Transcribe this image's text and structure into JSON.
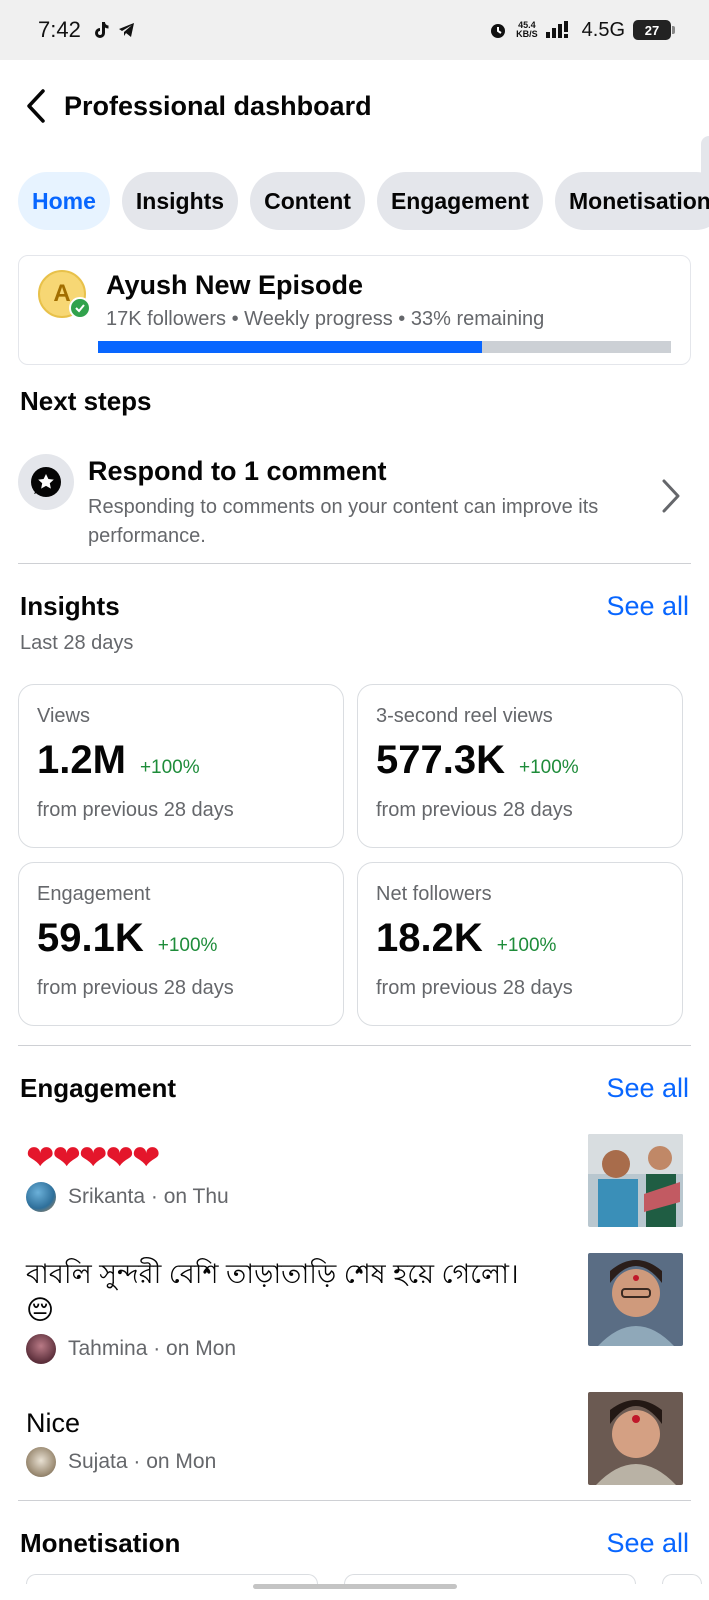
{
  "status_bar": {
    "time": "7:42",
    "speed_top": "45.4",
    "speed_bottom": "KB/S",
    "network": "4.5G",
    "battery": "27"
  },
  "header": {
    "title": "Professional dashboard"
  },
  "tabs": [
    {
      "label": "Home",
      "active": true
    },
    {
      "label": "Insights",
      "active": false
    },
    {
      "label": "Content",
      "active": false
    },
    {
      "label": "Engagement",
      "active": false
    },
    {
      "label": "Monetisation",
      "active": false
    }
  ],
  "profile": {
    "avatar_letter": "A",
    "name": "Ayush New Episode",
    "meta": "17K followers • Weekly progress • 33% remaining",
    "progress_fraction": 0.67
  },
  "next_steps": {
    "heading": "Next steps",
    "item": {
      "title": "Respond to 1 comment",
      "description": "Responding to comments on your content can improve its performance."
    }
  },
  "insights": {
    "heading": "Insights",
    "see_all": "See all",
    "period": "Last 28 days",
    "metrics": [
      {
        "label": "Views",
        "value": "1.2M",
        "change": "+100%",
        "foot": "from previous 28 days"
      },
      {
        "label": "3-second reel views",
        "value": "577.3K",
        "change": "+100%",
        "foot": "from previous 28 days"
      },
      {
        "label": "Engagement",
        "value": "59.1K",
        "change": "+100%",
        "foot": "from previous 28 days"
      },
      {
        "label": "Net followers",
        "value": "18.2K",
        "change": "+100%",
        "foot": "from previous 28 days"
      }
    ]
  },
  "engagement": {
    "heading": "Engagement",
    "see_all": "See all",
    "items": [
      {
        "text": "❤❤❤❤❤",
        "meta": "Srikanta · on Thu"
      },
      {
        "text": "বাবলি সুন্দরী বেশি তাড়াতাড়ি শেষ হয়ে গেলো।",
        "emoji": "😔",
        "meta": "Tahmina · on Mon"
      },
      {
        "text": "Nice",
        "meta": "Sujata · on Mon"
      }
    ]
  },
  "monetisation": {
    "heading": "Monetisation",
    "see_all": "See all"
  },
  "colors": {
    "accent": "#0866ff",
    "positive": "#1e8c3a",
    "muted": "#65676b"
  }
}
